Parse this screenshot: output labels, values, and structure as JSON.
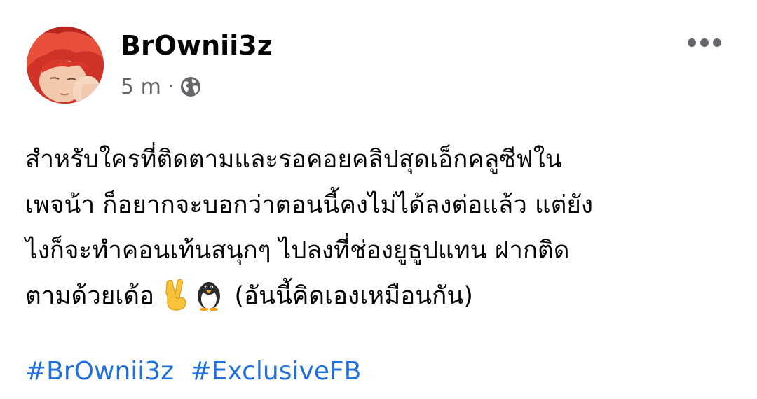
{
  "post": {
    "author": {
      "name": "BrOwnii3z"
    },
    "timestamp": "5 m",
    "separator": "·",
    "audience_icon": "globe-icon",
    "more_icon": "more-horizontal-icon",
    "body_lines": [
      "สำหรับใครที่ติดตามและรอคอยคลิปสุดเอ็กคลูซีฟใน",
      "เพจน้า ก็อยากจะบอกว่าตอนนี้คงไม่ได้ลงต่อแล้ว  แต่ยัง",
      "ไงก็จะทำคอนเท้นสนุกๆ ไปลงที่ช่องยูธูปแทน ฝากติด",
      "ตามด้วยเด้อ",
      "(อันนี้คิดเองเหมือนกัน)"
    ],
    "emojis": [
      "victory-hand-icon",
      "penguin-icon"
    ],
    "hashtags": [
      "#BrOwnii3z",
      "#ExclusiveFB"
    ]
  },
  "colors": {
    "text": "#050505",
    "secondary_text": "#65676b",
    "link": "#216fdb",
    "avatar_hair": "#d23a2e"
  }
}
